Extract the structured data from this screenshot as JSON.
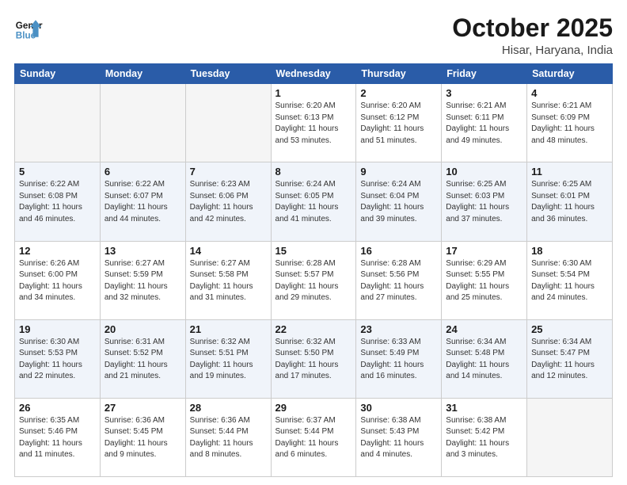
{
  "header": {
    "logo_general": "General",
    "logo_blue": "Blue",
    "month": "October 2025",
    "location": "Hisar, Haryana, India"
  },
  "days_of_week": [
    "Sunday",
    "Monday",
    "Tuesday",
    "Wednesday",
    "Thursday",
    "Friday",
    "Saturday"
  ],
  "weeks": [
    [
      {
        "day": "",
        "empty": true
      },
      {
        "day": "",
        "empty": true
      },
      {
        "day": "",
        "empty": true
      },
      {
        "day": "1",
        "sunrise": "6:20 AM",
        "sunset": "6:13 PM",
        "daylight": "11 hours and 53 minutes."
      },
      {
        "day": "2",
        "sunrise": "6:20 AM",
        "sunset": "6:12 PM",
        "daylight": "11 hours and 51 minutes."
      },
      {
        "day": "3",
        "sunrise": "6:21 AM",
        "sunset": "6:11 PM",
        "daylight": "11 hours and 49 minutes."
      },
      {
        "day": "4",
        "sunrise": "6:21 AM",
        "sunset": "6:09 PM",
        "daylight": "11 hours and 48 minutes."
      }
    ],
    [
      {
        "day": "5",
        "sunrise": "6:22 AM",
        "sunset": "6:08 PM",
        "daylight": "11 hours and 46 minutes."
      },
      {
        "day": "6",
        "sunrise": "6:22 AM",
        "sunset": "6:07 PM",
        "daylight": "11 hours and 44 minutes."
      },
      {
        "day": "7",
        "sunrise": "6:23 AM",
        "sunset": "6:06 PM",
        "daylight": "11 hours and 42 minutes."
      },
      {
        "day": "8",
        "sunrise": "6:24 AM",
        "sunset": "6:05 PM",
        "daylight": "11 hours and 41 minutes."
      },
      {
        "day": "9",
        "sunrise": "6:24 AM",
        "sunset": "6:04 PM",
        "daylight": "11 hours and 39 minutes."
      },
      {
        "day": "10",
        "sunrise": "6:25 AM",
        "sunset": "6:03 PM",
        "daylight": "11 hours and 37 minutes."
      },
      {
        "day": "11",
        "sunrise": "6:25 AM",
        "sunset": "6:01 PM",
        "daylight": "11 hours and 36 minutes."
      }
    ],
    [
      {
        "day": "12",
        "sunrise": "6:26 AM",
        "sunset": "6:00 PM",
        "daylight": "11 hours and 34 minutes."
      },
      {
        "day": "13",
        "sunrise": "6:27 AM",
        "sunset": "5:59 PM",
        "daylight": "11 hours and 32 minutes."
      },
      {
        "day": "14",
        "sunrise": "6:27 AM",
        "sunset": "5:58 PM",
        "daylight": "11 hours and 31 minutes."
      },
      {
        "day": "15",
        "sunrise": "6:28 AM",
        "sunset": "5:57 PM",
        "daylight": "11 hours and 29 minutes."
      },
      {
        "day": "16",
        "sunrise": "6:28 AM",
        "sunset": "5:56 PM",
        "daylight": "11 hours and 27 minutes."
      },
      {
        "day": "17",
        "sunrise": "6:29 AM",
        "sunset": "5:55 PM",
        "daylight": "11 hours and 25 minutes."
      },
      {
        "day": "18",
        "sunrise": "6:30 AM",
        "sunset": "5:54 PM",
        "daylight": "11 hours and 24 minutes."
      }
    ],
    [
      {
        "day": "19",
        "sunrise": "6:30 AM",
        "sunset": "5:53 PM",
        "daylight": "11 hours and 22 minutes."
      },
      {
        "day": "20",
        "sunrise": "6:31 AM",
        "sunset": "5:52 PM",
        "daylight": "11 hours and 21 minutes."
      },
      {
        "day": "21",
        "sunrise": "6:32 AM",
        "sunset": "5:51 PM",
        "daylight": "11 hours and 19 minutes."
      },
      {
        "day": "22",
        "sunrise": "6:32 AM",
        "sunset": "5:50 PM",
        "daylight": "11 hours and 17 minutes."
      },
      {
        "day": "23",
        "sunrise": "6:33 AM",
        "sunset": "5:49 PM",
        "daylight": "11 hours and 16 minutes."
      },
      {
        "day": "24",
        "sunrise": "6:34 AM",
        "sunset": "5:48 PM",
        "daylight": "11 hours and 14 minutes."
      },
      {
        "day": "25",
        "sunrise": "6:34 AM",
        "sunset": "5:47 PM",
        "daylight": "11 hours and 12 minutes."
      }
    ],
    [
      {
        "day": "26",
        "sunrise": "6:35 AM",
        "sunset": "5:46 PM",
        "daylight": "11 hours and 11 minutes."
      },
      {
        "day": "27",
        "sunrise": "6:36 AM",
        "sunset": "5:45 PM",
        "daylight": "11 hours and 9 minutes."
      },
      {
        "day": "28",
        "sunrise": "6:36 AM",
        "sunset": "5:44 PM",
        "daylight": "11 hours and 8 minutes."
      },
      {
        "day": "29",
        "sunrise": "6:37 AM",
        "sunset": "5:44 PM",
        "daylight": "11 hours and 6 minutes."
      },
      {
        "day": "30",
        "sunrise": "6:38 AM",
        "sunset": "5:43 PM",
        "daylight": "11 hours and 4 minutes."
      },
      {
        "day": "31",
        "sunrise": "6:38 AM",
        "sunset": "5:42 PM",
        "daylight": "11 hours and 3 minutes."
      },
      {
        "day": "",
        "empty": true
      }
    ]
  ]
}
